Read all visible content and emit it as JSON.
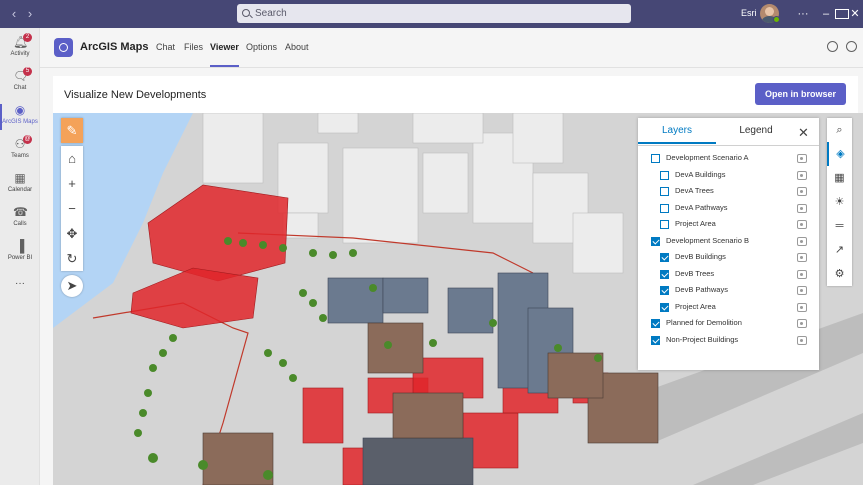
{
  "titlebar": {
    "search_placeholder": "Search",
    "user_name": "Esri",
    "back_icon": "chevron-left-icon",
    "forward_icon": "chevron-right-icon",
    "more_label": "···",
    "minimize_label": "–",
    "maximize_label": "☐",
    "close_label": "✕"
  },
  "rail": {
    "items": [
      {
        "label": "Activity",
        "icon": "bell-icon",
        "badge": "2"
      },
      {
        "label": "Chat",
        "icon": "chat-icon",
        "badge": "5"
      },
      {
        "label": "ArcGIS Maps",
        "icon": "arcgis-icon",
        "badge": ""
      },
      {
        "label": "Teams",
        "icon": "teams-icon",
        "badge": "@"
      },
      {
        "label": "Calendar",
        "icon": "calendar-icon",
        "badge": ""
      },
      {
        "label": "Calls",
        "icon": "phone-icon",
        "badge": ""
      },
      {
        "label": "Power BI",
        "icon": "powerbi-icon",
        "badge": ""
      }
    ],
    "more_label": "···"
  },
  "app": {
    "name": "ArcGIS Maps",
    "tabs": [
      "Chat",
      "Files",
      "Viewer",
      "Options",
      "About"
    ],
    "active_tab": "Viewer"
  },
  "card": {
    "title": "Visualize New Developments",
    "open_button": "Open in browser"
  },
  "map_toolbar": {
    "buttons": [
      "pencil-icon",
      "home-icon",
      "zoom-in-icon",
      "zoom-out-icon",
      "pan-icon",
      "rotate-icon",
      "compass-icon"
    ]
  },
  "layer_panel": {
    "tabs": [
      "Layers",
      "Legend"
    ],
    "active_tab": "Layers",
    "close_label": "✕",
    "layers": [
      {
        "name": "Development Scenario A",
        "checked": false,
        "child": false
      },
      {
        "name": "DevA Buildings",
        "checked": false,
        "child": true
      },
      {
        "name": "DevA Trees",
        "checked": false,
        "child": true
      },
      {
        "name": "DevA Pathways",
        "checked": false,
        "child": true
      },
      {
        "name": "Project Area",
        "checked": false,
        "child": true
      },
      {
        "name": "Development Scenario B",
        "checked": true,
        "child": false
      },
      {
        "name": "DevB Buildings",
        "checked": true,
        "child": true
      },
      {
        "name": "DevB Trees",
        "checked": true,
        "child": true
      },
      {
        "name": "DevB Pathways",
        "checked": true,
        "child": true
      },
      {
        "name": "Project Area",
        "checked": true,
        "child": true
      },
      {
        "name": "Planned for Demolition",
        "checked": true,
        "child": false
      },
      {
        "name": "Non-Project Buildings",
        "checked": true,
        "child": false
      }
    ]
  },
  "right_toolbar": {
    "buttons": [
      "search-icon",
      "layers-icon",
      "basemap-icon",
      "daylight-icon",
      "measure-icon",
      "share-icon",
      "settings-icon"
    ],
    "active": "layers-icon"
  },
  "colors": {
    "teams_purple": "#464775",
    "accent": "#5b5fc7",
    "esri_blue": "#007ac2",
    "demolition_red": "#e0262a",
    "water": "#b3d4f5"
  }
}
